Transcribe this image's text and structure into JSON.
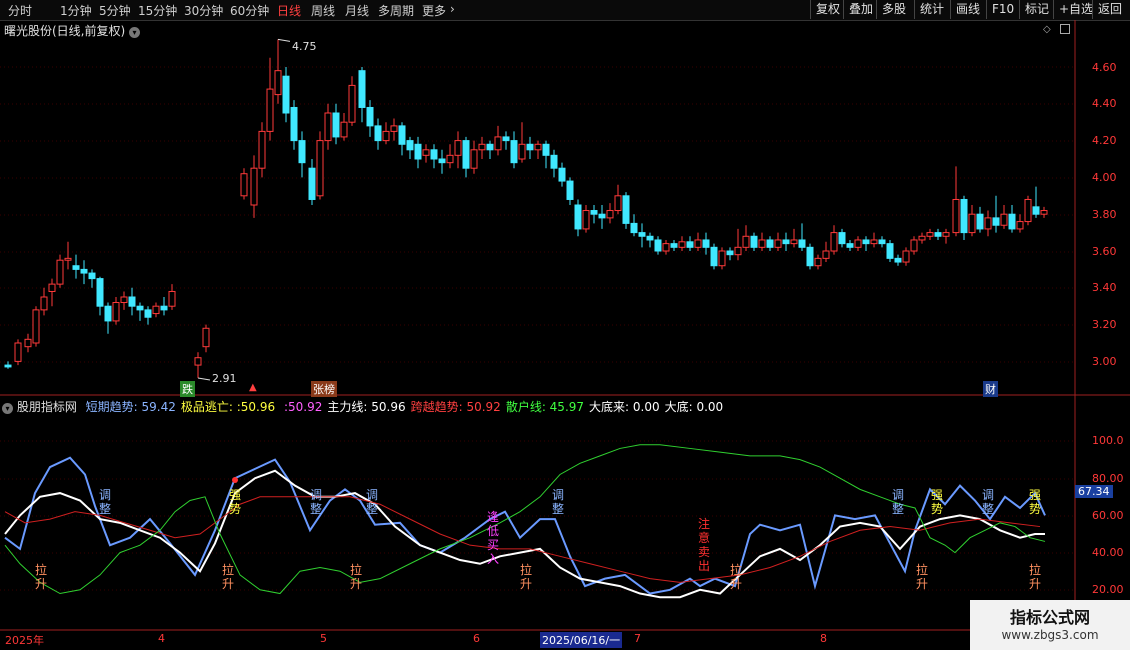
{
  "toolbar": {
    "periods": [
      "分时",
      "1分钟",
      "5分钟",
      "15分钟",
      "30分钟",
      "60分钟",
      "日线",
      "周线",
      "月线",
      "多周期",
      "更多"
    ],
    "active": "日线",
    "more_arrow": "›",
    "right_buttons": [
      "复权",
      "叠加",
      "多股",
      "统计",
      "画线",
      "F10",
      "标记",
      "+自选",
      "返回"
    ]
  },
  "main_chart": {
    "title": "曙光股份(日线,前复权)",
    "high_label": "4.75",
    "low_label": "2.91",
    "y_ticks": [
      "4.60",
      "4.40",
      "4.20",
      "4.00",
      "3.80",
      "3.60",
      "3.40",
      "3.20",
      "3.00"
    ],
    "tags": {
      "die": "跌",
      "zhangbang": "张榜",
      "cai": "财"
    }
  },
  "indicator": {
    "name": "股朋指标网",
    "fields": [
      {
        "label": "短期趋势:",
        "value": "59.42",
        "color": "#8ab4ff"
      },
      {
        "label": "极品逃亡:",
        "value": ":50.96",
        "color": "#ffff40"
      },
      {
        "label": "",
        "value": ":50.92",
        "color": "#ff60ff"
      },
      {
        "label": "主力线:",
        "value": "50.96",
        "color": "#ffffff"
      },
      {
        "label": "跨越趋势:",
        "value": "50.92",
        "color": "#ff4040"
      },
      {
        "label": "散户线:",
        "value": "45.97",
        "color": "#40ff40"
      },
      {
        "label": "大底来:",
        "value": "0.00",
        "color": "#ffffff"
      },
      {
        "label": "大底:",
        "value": "0.00",
        "color": "#ffffff"
      }
    ],
    "y_ticks": [
      "100.0",
      "80.00",
      "60.00",
      "40.00",
      "20.00"
    ],
    "current_value": "67.34",
    "signals": {
      "lasheng": "拉升",
      "tiaozheng": "调整",
      "qiangshi": "强势",
      "fengdi": "逢低买入",
      "zhuyi": "注意卖出"
    }
  },
  "x_axis": {
    "labels": [
      "2025年",
      "4",
      "5",
      "6",
      "2025/06/16/一",
      "7",
      "8"
    ]
  },
  "watermark": {
    "title": "指标公式网",
    "url": "www.zbgs3.com"
  }
}
